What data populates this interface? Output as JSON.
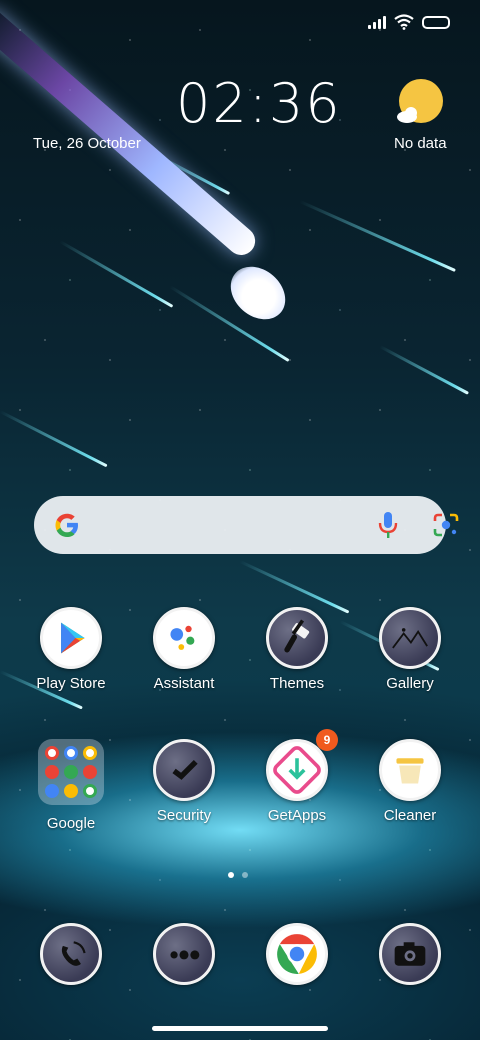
{
  "status_bar": {
    "icons": [
      "signal-icon",
      "wifi-icon",
      "battery-icon"
    ]
  },
  "clock": {
    "time": "02:36",
    "date": "Tue, 26 October"
  },
  "weather": {
    "text": "No data",
    "icon": "partly-cloudy-icon"
  },
  "search_bar": {
    "icons": [
      "google-g-icon",
      "microphone-icon",
      "google-lens-icon"
    ]
  },
  "apps_row1": [
    {
      "label": "Play Store"
    },
    {
      "label": "Assistant"
    },
    {
      "label": "Themes"
    },
    {
      "label": "Gallery"
    }
  ],
  "apps_row2": [
    {
      "label": "Google"
    },
    {
      "label": "Security"
    },
    {
      "label": "GetApps",
      "badge": "9"
    },
    {
      "label": "Cleaner"
    }
  ],
  "dock": [
    {
      "icon": "phone-icon"
    },
    {
      "icon": "messages-icon"
    },
    {
      "icon": "chrome-icon"
    },
    {
      "icon": "camera-icon"
    }
  ],
  "page_indicator": {
    "pages": 2,
    "current": 1
  }
}
